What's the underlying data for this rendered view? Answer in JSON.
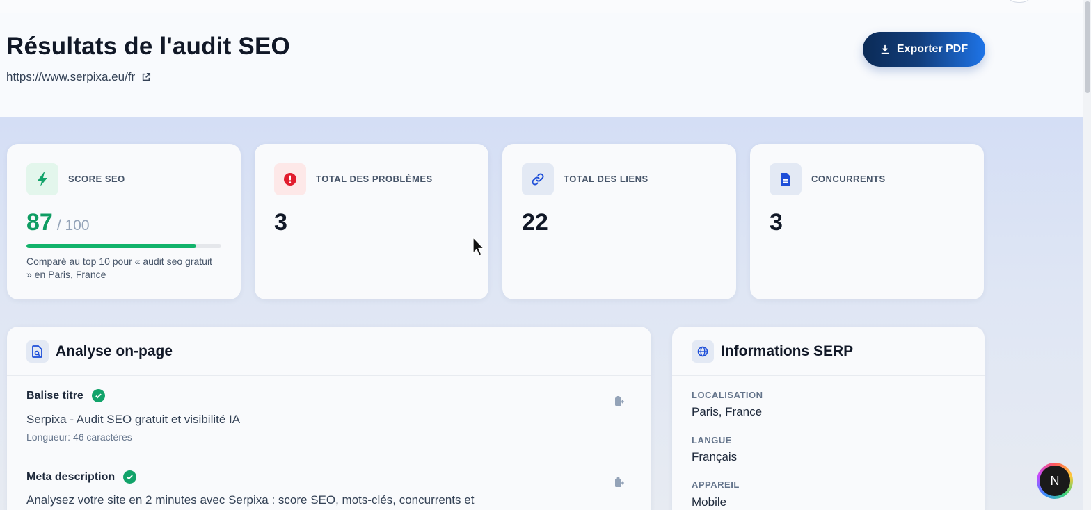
{
  "header": {
    "title": "Résultats de l'audit SEO",
    "url": "https://www.serpixa.eu/fr",
    "export_label": "Exporter PDF"
  },
  "stats": [
    {
      "label": "SCORE SEO",
      "value": "87",
      "max": "/ 100",
      "progress_pct": 87,
      "icon": "bolt-icon",
      "color": "#12b36b"
    },
    {
      "label": "TOTAL DES PROBLÈMES",
      "value": "3",
      "icon": "alert-icon",
      "color": "#e11d2e"
    },
    {
      "label": "TOTAL DES LIENS",
      "value": "22",
      "icon": "link-icon",
      "color": "#1d4ed8"
    },
    {
      "label": "CONCURRENTS",
      "value": "3",
      "icon": "document-icon",
      "color": "#1d4ed8"
    }
  ],
  "score_note": "Comparé au top 10 pour « audit seo gratuit » en Paris, France",
  "onpage": {
    "title": "Analyse on-page",
    "items": [
      {
        "title": "Balise titre",
        "value": "Serpixa - Audit SEO gratuit et visibilité IA",
        "meta": "Longueur: 46 caractères"
      },
      {
        "title": "Meta description",
        "value": "Analysez votre site en 2 minutes avec Serpixa : score SEO, mots-clés, concurrents et"
      }
    ]
  },
  "serp": {
    "title": "Informations SERP",
    "fields": [
      {
        "label": "LOCALISATION",
        "value": "Paris, France"
      },
      {
        "label": "LANGUE",
        "value": "Français"
      },
      {
        "label": "APPAREIL",
        "value": "Mobile"
      }
    ]
  },
  "badge": {
    "letter": "N"
  },
  "colors": {
    "accent_green": "#0f9d63",
    "accent_blue": "#1e74e8",
    "navy": "#0b2b57"
  }
}
